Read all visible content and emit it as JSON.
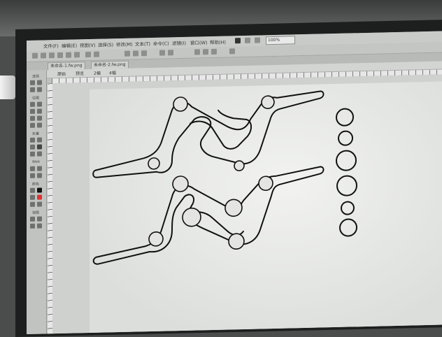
{
  "menu": {
    "items": [
      "文件(F)",
      "编辑(E)",
      "视图(V)",
      "选择(S)",
      "修改(M)",
      "文本(T)",
      "命令(C)",
      "滤镜(I)",
      "窗口(W)",
      "帮助(H)"
    ],
    "zoom": "100%"
  },
  "tabs": {
    "documents": [
      "未命名-1.fw.png",
      "未命名-2.fw.png"
    ]
  },
  "subtabs": {
    "items": [
      "原始",
      "预览",
      "2幅",
      "4幅"
    ]
  },
  "tools": {
    "sections": [
      "选择",
      "位图",
      "矢量",
      "Web",
      "颜色",
      "视图"
    ]
  }
}
